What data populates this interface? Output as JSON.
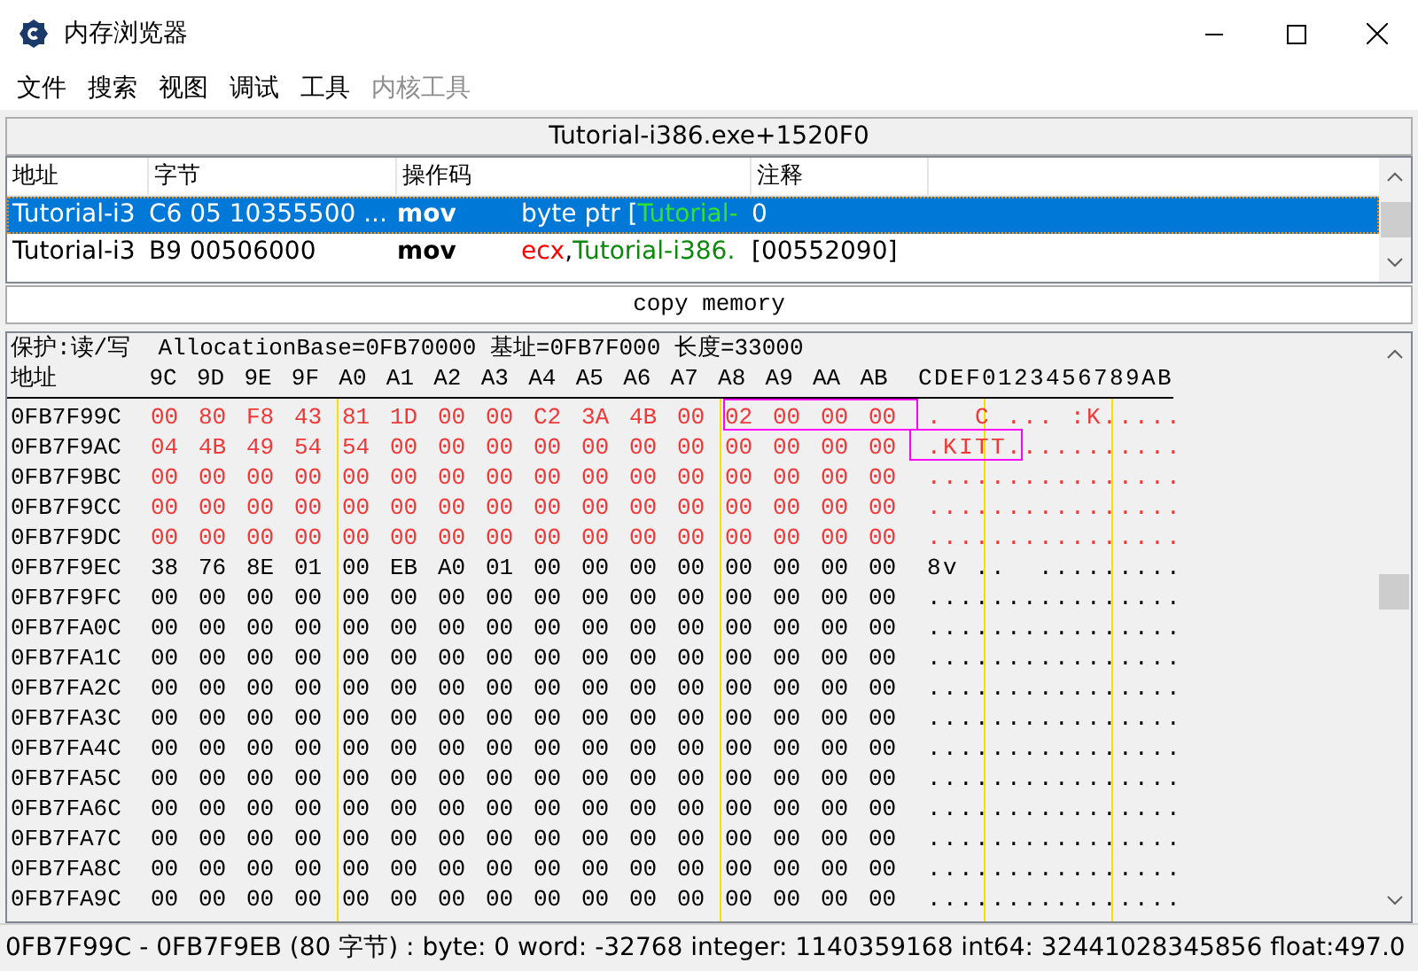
{
  "window": {
    "title": "内存浏览器"
  },
  "menu": [
    {
      "label": "文件",
      "disabled": false
    },
    {
      "label": "搜索",
      "disabled": false
    },
    {
      "label": "视图",
      "disabled": false
    },
    {
      "label": "调试",
      "disabled": false
    },
    {
      "label": "工具",
      "disabled": false
    },
    {
      "label": "内核工具",
      "disabled": true
    }
  ],
  "address_bar": "Tutorial-i386.exe+1520F0",
  "disassembly": {
    "columns": [
      "地址",
      "字节",
      "操作码",
      "注释"
    ],
    "rows": [
      {
        "selected": true,
        "address": "Tutorial-i3",
        "bytes": "C6 05 10355500 ...",
        "opcode": "mov",
        "operands": [
          {
            "kind": "plain",
            "text": "byte ptr ["
          },
          {
            "kind": "symbol",
            "text": "Tutorial-"
          }
        ],
        "comment": "0"
      },
      {
        "selected": false,
        "address": "Tutorial-i3",
        "bytes": "B9 00506000",
        "opcode": "mov",
        "operands": [
          {
            "kind": "register",
            "text": "ecx"
          },
          {
            "kind": "plain",
            "text": ","
          },
          {
            "kind": "symbol",
            "text": "Tutorial-i386."
          }
        ],
        "comment": "[00552090]"
      }
    ]
  },
  "copy_button": "copy memory",
  "hex_view": {
    "info": "保护:读/写  AllocationBase=0FB70000 基址=0FB7F000 长度=33000",
    "address_header": "地址",
    "column_headers": [
      "9C",
      "9D",
      "9E",
      "9F",
      "A0",
      "A1",
      "A2",
      "A3",
      "A4",
      "A5",
      "A6",
      "A7",
      "A8",
      "A9",
      "AA",
      "AB"
    ],
    "ascii_header": "CDEF0123456789AB",
    "rows": [
      {
        "address": "0FB7F99C",
        "changed": true,
        "hex_cursor": true,
        "bytes": "00 80 F8 43 81 1D 00 00 C2 3A 4B 00 02 00 00 00",
        "ascii": ".  C ... :K....."
      },
      {
        "address": "0FB7F9AC",
        "changed": true,
        "ascii_cursor": true,
        "bytes": "04 4B 49 54 54 00 00 00 00 00 00 00 00 00 00 00",
        "ascii": ".KITT..........."
      },
      {
        "address": "0FB7F9BC",
        "changed": true,
        "bytes": "00 00 00 00 00 00 00 00 00 00 00 00 00 00 00 00",
        "ascii": "................"
      },
      {
        "address": "0FB7F9CC",
        "changed": true,
        "bytes": "00 00 00 00 00 00 00 00 00 00 00 00 00 00 00 00",
        "ascii": "................"
      },
      {
        "address": "0FB7F9DC",
        "changed": true,
        "bytes": "00 00 00 00 00 00 00 00 00 00 00 00 00 00 00 00",
        "ascii": "................"
      },
      {
        "address": "0FB7F9EC",
        "changed": false,
        "bytes": "38 76 8E 01 00 EB A0 01 00 00 00 00 00 00 00 00",
        "ascii": "8v ..  ........."
      },
      {
        "address": "0FB7F9FC",
        "changed": false,
        "bytes": "00 00 00 00 00 00 00 00 00 00 00 00 00 00 00 00",
        "ascii": "................"
      },
      {
        "address": "0FB7FA0C",
        "changed": false,
        "bytes": "00 00 00 00 00 00 00 00 00 00 00 00 00 00 00 00",
        "ascii": "................"
      },
      {
        "address": "0FB7FA1C",
        "changed": false,
        "bytes": "00 00 00 00 00 00 00 00 00 00 00 00 00 00 00 00",
        "ascii": "................"
      },
      {
        "address": "0FB7FA2C",
        "changed": false,
        "bytes": "00 00 00 00 00 00 00 00 00 00 00 00 00 00 00 00",
        "ascii": "................"
      },
      {
        "address": "0FB7FA3C",
        "changed": false,
        "bytes": "00 00 00 00 00 00 00 00 00 00 00 00 00 00 00 00",
        "ascii": "................"
      },
      {
        "address": "0FB7FA4C",
        "changed": false,
        "bytes": "00 00 00 00 00 00 00 00 00 00 00 00 00 00 00 00",
        "ascii": "................"
      },
      {
        "address": "0FB7FA5C",
        "changed": false,
        "bytes": "00 00 00 00 00 00 00 00 00 00 00 00 00 00 00 00",
        "ascii": "................"
      },
      {
        "address": "0FB7FA6C",
        "changed": false,
        "bytes": "00 00 00 00 00 00 00 00 00 00 00 00 00 00 00 00",
        "ascii": "................"
      },
      {
        "address": "0FB7FA7C",
        "changed": false,
        "bytes": "00 00 00 00 00 00 00 00 00 00 00 00 00 00 00 00",
        "ascii": "................"
      },
      {
        "address": "0FB7FA8C",
        "changed": false,
        "bytes": "00 00 00 00 00 00 00 00 00 00 00 00 00 00 00 00",
        "ascii": "................"
      },
      {
        "address": "0FB7FA9C",
        "changed": false,
        "bytes": "00 00 00 00 00 00 00 00 00 00 00 00 00 00 00 00",
        "ascii": "................"
      }
    ]
  },
  "status_bar": "0FB7F99C - 0FB7F9EB (80 字节) : byte: 0 word: -32768 integer: 1140359168 int64: 32441028345856 float:497.0"
}
